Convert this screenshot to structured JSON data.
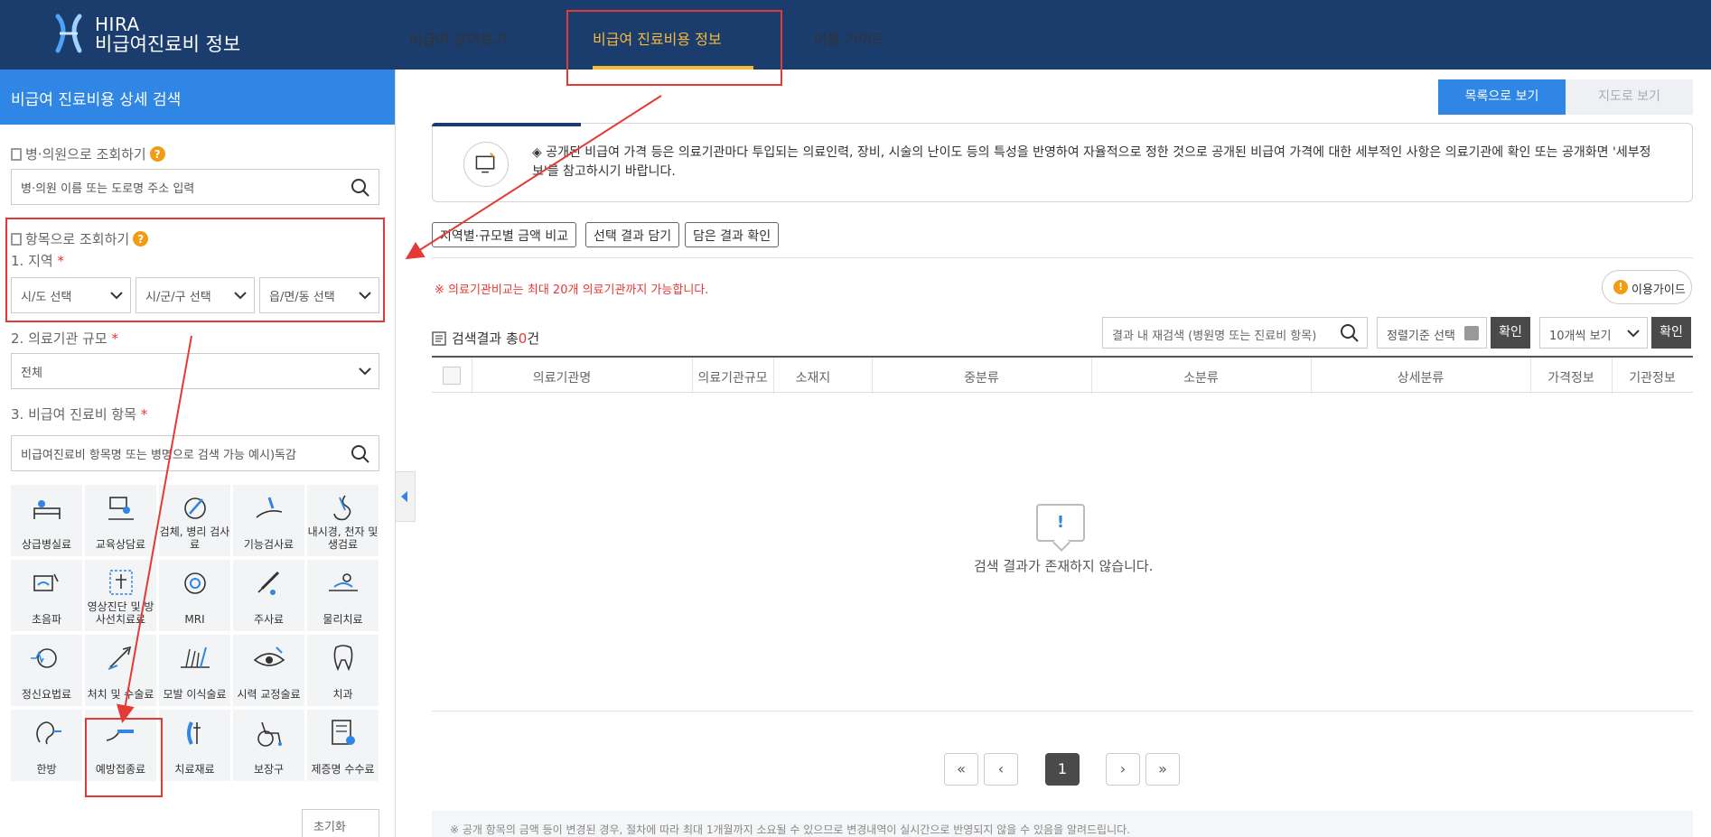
{
  "header": {
    "brand_line1": "HIRA",
    "brand_line2": "비급여진료비 정보",
    "nav": [
      "비급여 알아보기",
      "비급여 진료비용 정보",
      "이용 가이드"
    ]
  },
  "sidebar": {
    "title": "비급여 진료비용 상세 검색",
    "hospital_search_label": "병·의원으로 조회하기",
    "hospital_search_placeholder": "병·의원 이름 또는 도로명 주소 입력",
    "item_search_label": "항목으로 조회하기",
    "region_label": "1. 지역",
    "region_selects": [
      "시/도 선택",
      "시/군/구 선택",
      "읍/면/동 선택"
    ],
    "scale_label": "2. 의료기관 규모",
    "scale_value": "전체",
    "item_label": "3. 비급여 진료비 항목",
    "item_placeholder": "비급여진료비 항목명 또는 병명으로 검색 가능 예시)독감",
    "required_mark": "*",
    "categories": [
      "상급병실료",
      "교육상담료",
      "검체, 병리 검사료",
      "기능검사료",
      "내시경, 천자 및 생검료",
      "초음파",
      "영상진단 및 방사선치료료",
      "MRI",
      "주사료",
      "물리치료",
      "정신요법료",
      "처치 및 수술료",
      "모발 이식술료",
      "시력 교정술료",
      "치과",
      "한방",
      "예방접종료",
      "치료재료",
      "보장구",
      "제증명 수수료"
    ],
    "reset_label": "초기화"
  },
  "main": {
    "view_list": "목록으로 보기",
    "view_map": "지도로 보기",
    "notice": "◈ 공개된 비급여 가격 등은 의료기관마다 투입되는 의료인력, 장비, 시술의 난이도 등의 특성을 반영하여 자율적으로 정한 것으로 공개된 비급여 가격에 대한 세부적인 사항은 의료기관에 확인 또는 공개화면 '세부정보'를 참고하시기 바랍니다.",
    "actions": [
      "지역별·규모별 금액 비교",
      "선택 결과 담기",
      "담은 결과 확인"
    ],
    "warning": "※ 의료기관비교는 최대 20개 의료기관까지 가능합니다.",
    "guide_label": "이용가이드",
    "result_prefix": "검색결과 총",
    "result_count": "0",
    "result_suffix": "건",
    "result_search_placeholder": "결과 내 재검색 (병원명 또는 진료비 항목)",
    "sort_label": "정렬기준 선택",
    "confirm": "확인",
    "page_size": "10개씩 보기",
    "columns": [
      "의료기관명",
      "의료기관규모",
      "소재지",
      "중분류",
      "소분류",
      "상세분류",
      "가격정보",
      "기관정보"
    ],
    "empty_icon": "!",
    "empty_text": "검색 결과가 존재하지 않습니다.",
    "current_page": "1",
    "footer_note": "※ 공개 항목의 금액 등이 변경된 경우, 절차에 따라 최대 1개월까지 소요될 수 있으므로 변경내역이 실시간으로 반영되지 않을 수 있음을 알려드립니다."
  },
  "colors": {
    "header_bg": "#1a3d6d",
    "accent_blue": "#2f86e4",
    "active_nav": "#f6b93b",
    "annotation_red": "#e53935"
  }
}
